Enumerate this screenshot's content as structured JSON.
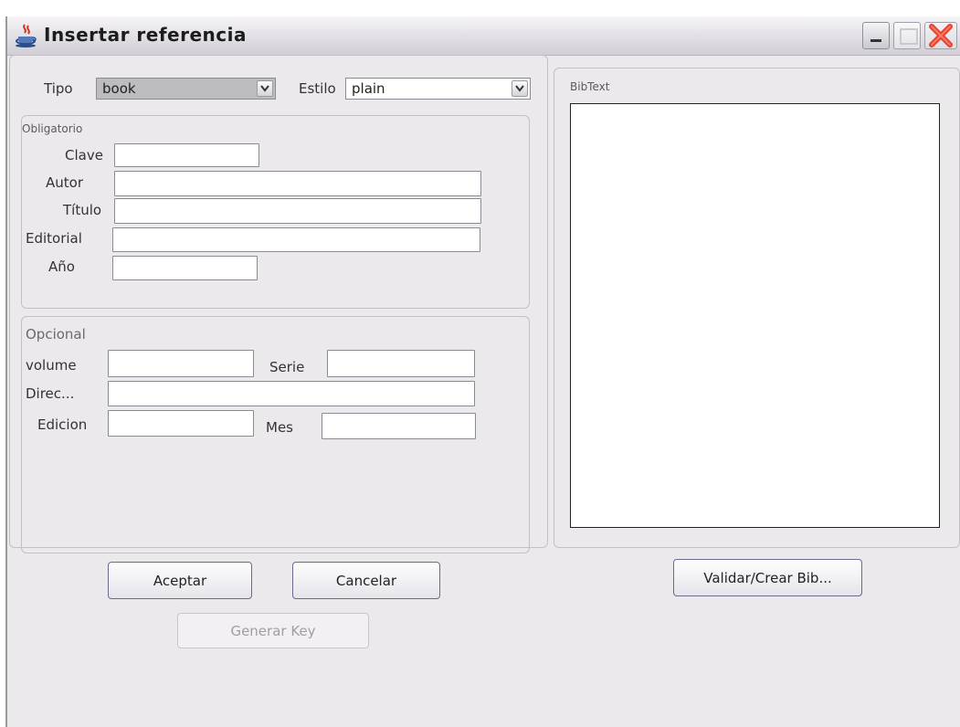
{
  "window": {
    "title": "Insertar referencia",
    "icon": "java-cup-icon"
  },
  "top": {
    "tipo_label": "Tipo",
    "tipo_value": "book",
    "estilo_label": "Estilo",
    "estilo_value": "plain"
  },
  "obligatorio": {
    "title": "Obligatorio",
    "fields": [
      {
        "label": "Clave",
        "value": ""
      },
      {
        "label": "Autor",
        "value": ""
      },
      {
        "label": "Título",
        "value": ""
      },
      {
        "label": "Editorial",
        "value": ""
      },
      {
        "label": "Año",
        "value": ""
      }
    ]
  },
  "opcional": {
    "title": "Opcional",
    "fields": [
      {
        "label": "volume",
        "value": ""
      },
      {
        "label": "Serie",
        "value": ""
      },
      {
        "label": "Direc...",
        "value": ""
      },
      {
        "label": "Edicion",
        "value": ""
      },
      {
        "label": "Mes",
        "value": ""
      }
    ]
  },
  "bibtext": {
    "title": "BibText",
    "content": ""
  },
  "buttons": {
    "aceptar": "Aceptar",
    "cancelar": "Cancelar",
    "generar_key": "Generar Key",
    "validar": "Validar/Crear Bib..."
  }
}
